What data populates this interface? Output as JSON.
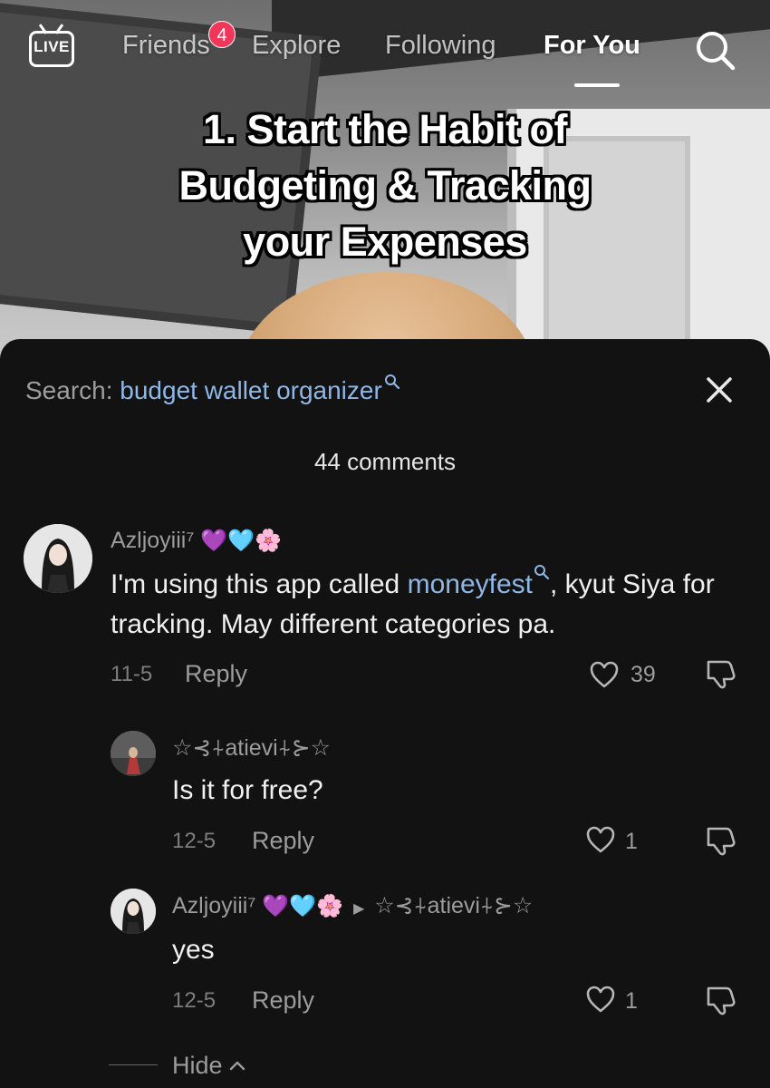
{
  "topnav": {
    "live_label": "LIVE",
    "tabs": [
      {
        "label": "Friends",
        "badge": "4"
      },
      {
        "label": "Explore"
      },
      {
        "label": "Following"
      },
      {
        "label": "For You",
        "active": true
      }
    ]
  },
  "video": {
    "caption_lines": [
      "1. Start the Habit of",
      "Budgeting & Tracking",
      "your Expenses"
    ]
  },
  "sheet": {
    "search_prefix": "Search: ",
    "search_term": "budget wallet organizer",
    "comment_count": "44 comments",
    "hide_label": "Hide"
  },
  "comments": [
    {
      "username": "Azljoyiii⁷",
      "emojis": "💜🩵🌸",
      "text_before": "I'm using this app called ",
      "link_text": "moneyfest",
      "text_after": ", kyut Siya for tracking. May different categories pa.",
      "date": "11-5",
      "reply_label": "Reply",
      "likes": "39"
    },
    {
      "username": "☆⊰⍭atievi⍭⊱☆",
      "text": "Is it for free?",
      "date": "12-5",
      "reply_label": "Reply",
      "likes": "1"
    },
    {
      "username": "Azljoyiii⁷",
      "emojis": "💜🩵🌸",
      "reply_to": "☆⊰⍭atievi⍭⊱☆",
      "text": "yes",
      "date": "12-5",
      "reply_label": "Reply",
      "likes": "1"
    }
  ],
  "colors": {
    "sheet_bg": "#121212",
    "link": "#8fb7e6",
    "badge": "#f1365a"
  }
}
